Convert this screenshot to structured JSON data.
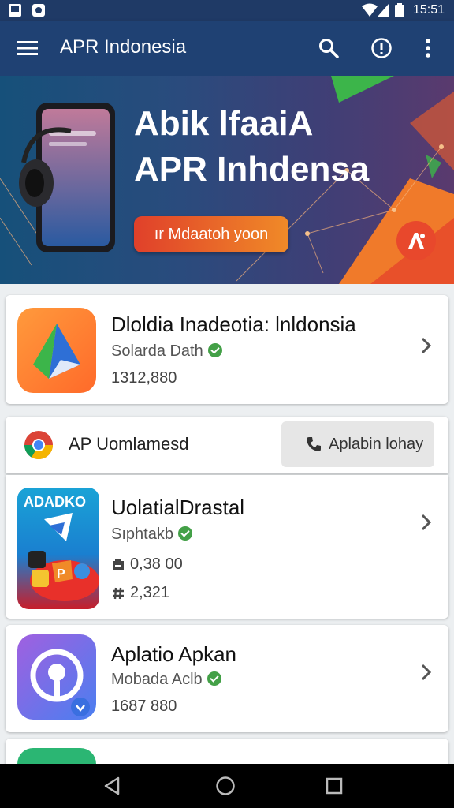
{
  "status_bar": {
    "time": "15:51"
  },
  "app_bar": {
    "title": "APR Indonesia",
    "icons": [
      "menu-icon",
      "search-icon",
      "info-icon",
      "more-vert-icon"
    ]
  },
  "hero": {
    "headline_line1": "Abik lfaaiA",
    "headline_line2": "APR Inhdensa",
    "cta_label": "ır Mdaatoh yoon",
    "fab_icon": "apk-logo-icon"
  },
  "featured_app": {
    "name": "Dloldia Inadeotia: lnldonsia",
    "developer": "Solarda Dath",
    "downloads": "1312,880"
  },
  "section": {
    "title": "AP Uomlamesd",
    "action_label": "Aplabin lohay"
  },
  "apps": [
    {
      "icon_label": "ADADKO",
      "name": "UolatialDrastal",
      "developer": "Sıphtakb",
      "size": "0,38 00",
      "rank": "2,321"
    },
    {
      "name": "Aplatio Apkan",
      "developer": "Mobada Aclb",
      "downloads": "1687 880"
    }
  ],
  "colors": {
    "app_bar": "#1f4173",
    "status_bar": "#1f3a66",
    "accent_orange": "#f08a28",
    "verified_green": "#43a047"
  }
}
